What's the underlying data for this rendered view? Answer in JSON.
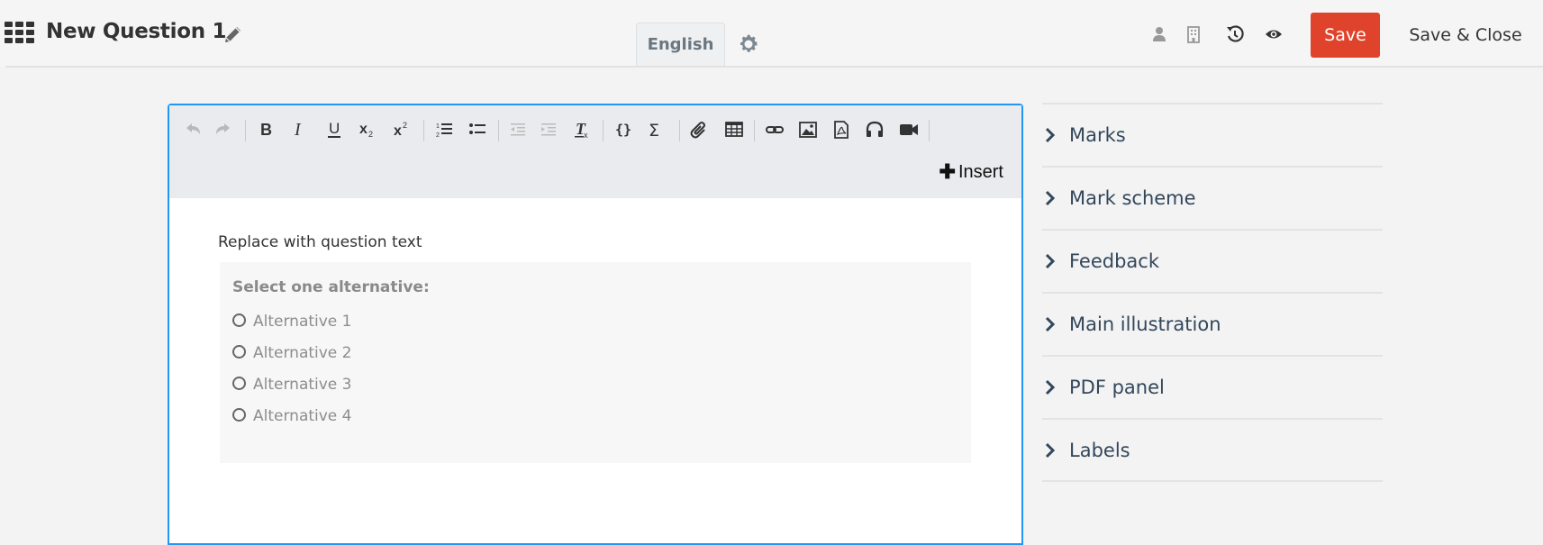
{
  "header": {
    "title": "New Question 1",
    "language_tab": "English",
    "save_label": "Save",
    "save_close_label": "Save & Close",
    "icons": [
      "apps-grid-icon",
      "pencil-icon",
      "gear-icon",
      "user-icon",
      "building-icon",
      "history-icon",
      "preview-eye-icon"
    ]
  },
  "editor": {
    "toolbar": {
      "buttons": [
        "undo",
        "redo",
        "bold",
        "italic",
        "underline",
        "subscript",
        "superscript",
        "numbered-list",
        "bulleted-list",
        "decrease-indent",
        "increase-indent",
        "clear-formatting",
        "code",
        "sum",
        "attachment",
        "table",
        "link",
        "image",
        "pdf",
        "audio",
        "video"
      ],
      "insert_label": "Insert"
    },
    "question_text": "Replace with question text",
    "alternatives": {
      "heading": "Select one alternative:",
      "items": [
        "Alternative 1",
        "Alternative 2",
        "Alternative 3",
        "Alternative 4"
      ]
    }
  },
  "sidebar": {
    "items": [
      {
        "label": "Marks"
      },
      {
        "label": "Mark scheme"
      },
      {
        "label": "Feedback"
      },
      {
        "label": "Main illustration"
      },
      {
        "label": "PDF panel"
      },
      {
        "label": "Labels"
      }
    ]
  },
  "colors": {
    "accent_blue": "#2196f3",
    "save_red": "#e0432b",
    "sidebar_text": "#33475b"
  }
}
